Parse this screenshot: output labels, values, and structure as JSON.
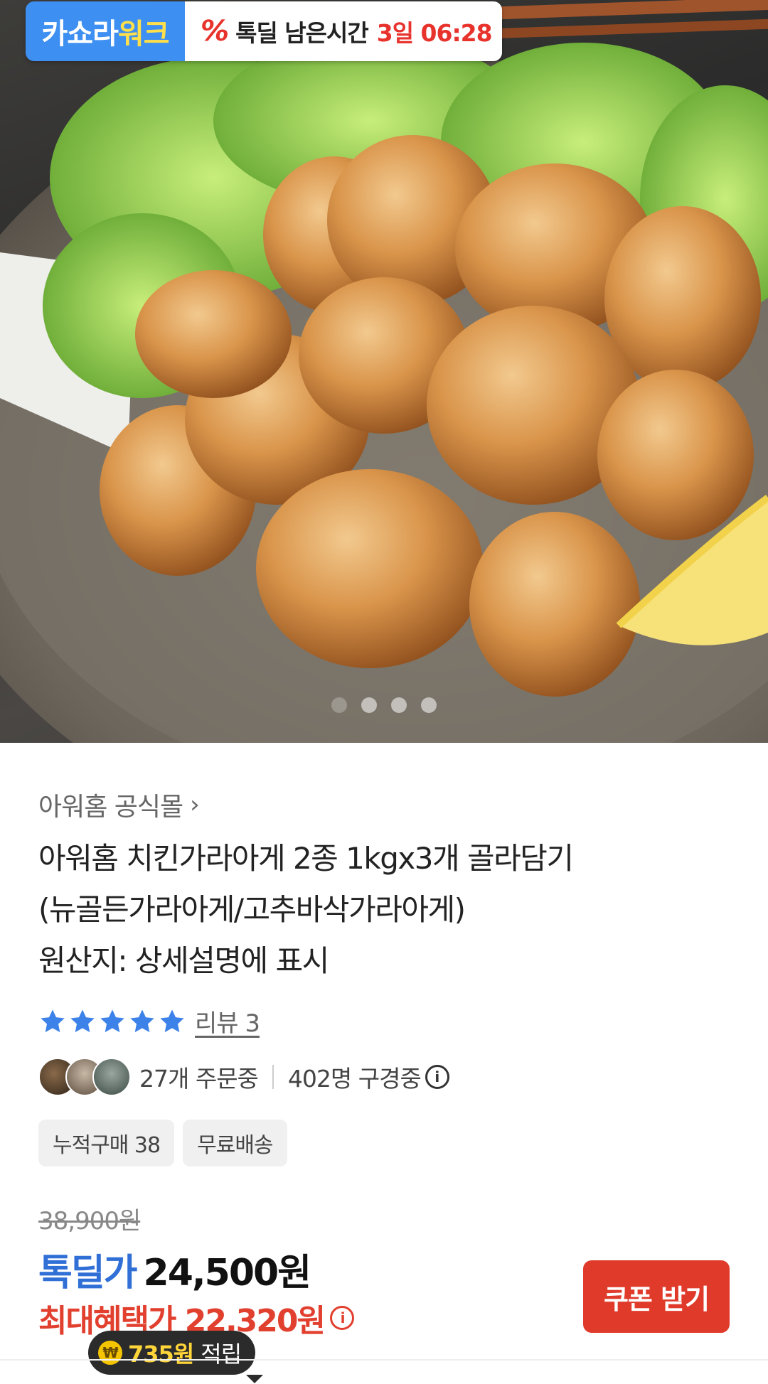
{
  "deal_badge": {
    "logo_prefix": "카쇼라",
    "logo_accent": "워크",
    "icon": "percent-icon",
    "timer_label": "톡딜 남은시간",
    "timer_value": "3일 06:28"
  },
  "carousel": {
    "total": 4,
    "active_index": 0
  },
  "product": {
    "seller": "아워홈 공식몰",
    "title_line1": "아워홈 치킨가라아게 2종 1kgx3개 골라담기",
    "title_line2": "(뉴골든가라아게/고추바삭가라아게)",
    "title_line3": "원산지: 상세설명에 표시",
    "rating_stars": 5,
    "review_label": "리뷰 3",
    "orders_text": "27개 주문중",
    "viewers_text": "402명 구경중",
    "chips": [
      "누적구매 38",
      "무료배송"
    ]
  },
  "price": {
    "original": "38,900원",
    "deal_label": "톡딜가",
    "deal_amount": "24,500원",
    "max_benefit": "최대혜택가 22,320원",
    "coupon_button": "쿠폰 받기",
    "reward_amount": "735원",
    "reward_suffix": "적립"
  },
  "colors": {
    "accent_blue": "#2f6fd6",
    "accent_red": "#e2402f",
    "logo_blue": "#3d8ff1"
  }
}
